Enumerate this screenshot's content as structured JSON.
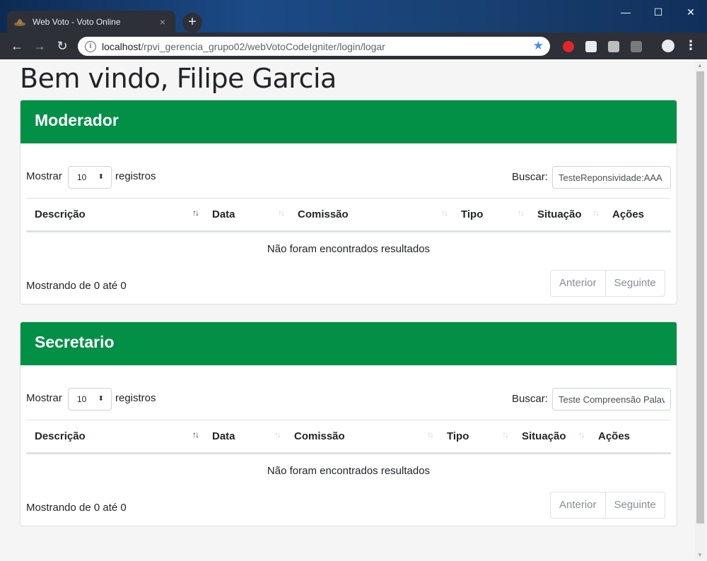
{
  "browser": {
    "tab_title": "Web Voto - Voto Online",
    "tab_close": "×",
    "new_tab": "+",
    "url_host": "localhost",
    "url_path": "/rpvi_gerencia_grupo02/webVotoCodeIgniter/login/logar",
    "window_controls": {
      "minimize": "—",
      "maximize": "☐",
      "close": "✕"
    },
    "nav": {
      "back": "←",
      "forward": "→",
      "reload": "↻"
    },
    "extensions": [
      "adblock-icon",
      "cube-icon",
      "m-icon",
      "se-icon"
    ],
    "accent": "#4a8af4"
  },
  "page": {
    "title": "Bem vindo, Filipe Garcia",
    "accent_color": "#028f46"
  },
  "panels": [
    {
      "title": "Moderador",
      "length_label": "Mostrar",
      "length_value": "10",
      "length_suffix": "registros",
      "search_label": "Buscar:",
      "search_value": "TesteReponsividade:AAA",
      "columns": [
        "Descrição",
        "Data",
        "Comissão",
        "Tipo",
        "Situação",
        "Ações"
      ],
      "empty_message": "Não foram encontrados resultados",
      "info": "Mostrando de 0 até 0",
      "prev": "Anterior",
      "next": "Seguinte"
    },
    {
      "title": "Secretario",
      "length_label": "Mostrar",
      "length_value": "10",
      "length_suffix": "registros",
      "search_label": "Buscar:",
      "search_value": "Teste Compreensão Palavra",
      "columns": [
        "Descrição",
        "Data",
        "Comissão",
        "Tipo",
        "Situação",
        "Ações"
      ],
      "empty_message": "Não foram encontrados resultados",
      "info": "Mostrando de 0 até 0",
      "prev": "Anterior",
      "next": "Seguinte"
    }
  ]
}
